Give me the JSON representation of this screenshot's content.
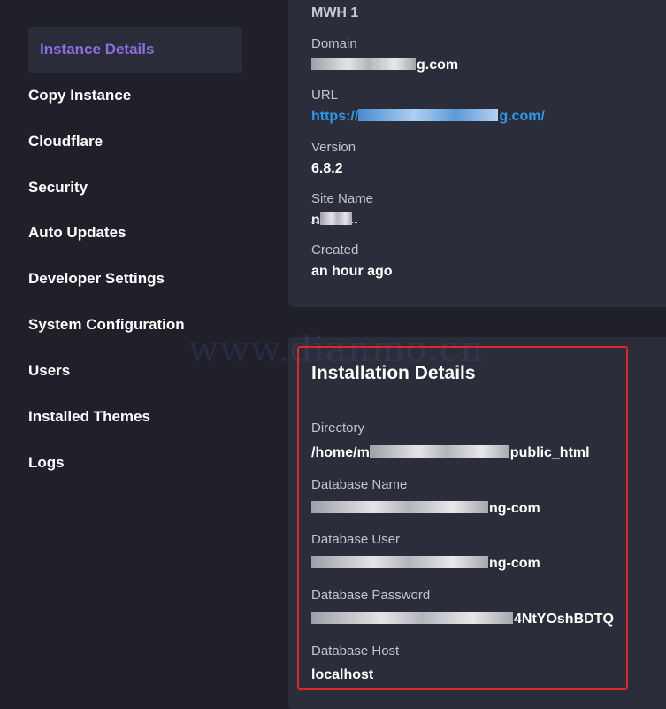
{
  "sidebar": {
    "items": [
      {
        "label": "Instance Details",
        "active": true
      },
      {
        "label": "Copy Instance"
      },
      {
        "label": "Cloudflare"
      },
      {
        "label": "Security"
      },
      {
        "label": "Auto Updates"
      },
      {
        "label": "Developer Settings"
      },
      {
        "label": "System Configuration"
      },
      {
        "label": "Users"
      },
      {
        "label": "Installed Themes"
      },
      {
        "label": "Logs"
      }
    ]
  },
  "instance": {
    "heading": "MWH 1",
    "domain_label": "Domain",
    "domain_value": "g.com",
    "url_label": "URL",
    "url_prefix": "https://",
    "url_suffix": "g.com/",
    "version_label": "Version",
    "version_value": "6.8.2",
    "site_name_label": "Site Name",
    "site_name_value": "n",
    "created_label": "Created",
    "created_value": "an hour ago"
  },
  "installation": {
    "title": "Installation Details",
    "directory_label": "Directory",
    "directory_prefix": "/home/m",
    "directory_suffix": "public_html",
    "db_name_label": "Database Name",
    "db_name_suffix": "ng-com",
    "db_user_label": "Database User",
    "db_user_suffix": "ng-com",
    "db_password_label": "Database Password",
    "db_password_suffix": "4NtYOshBDTQ",
    "db_host_label": "Database Host",
    "db_host_value": "localhost"
  },
  "watermark": "www.dianmo.cn",
  "colors": {
    "background": "#1f2029",
    "card": "#2c2d3a",
    "active_item_bg": "#2b2c39",
    "active_item_text": "#8a6de0",
    "link": "#2f97e8",
    "highlight": "#e0262b"
  }
}
